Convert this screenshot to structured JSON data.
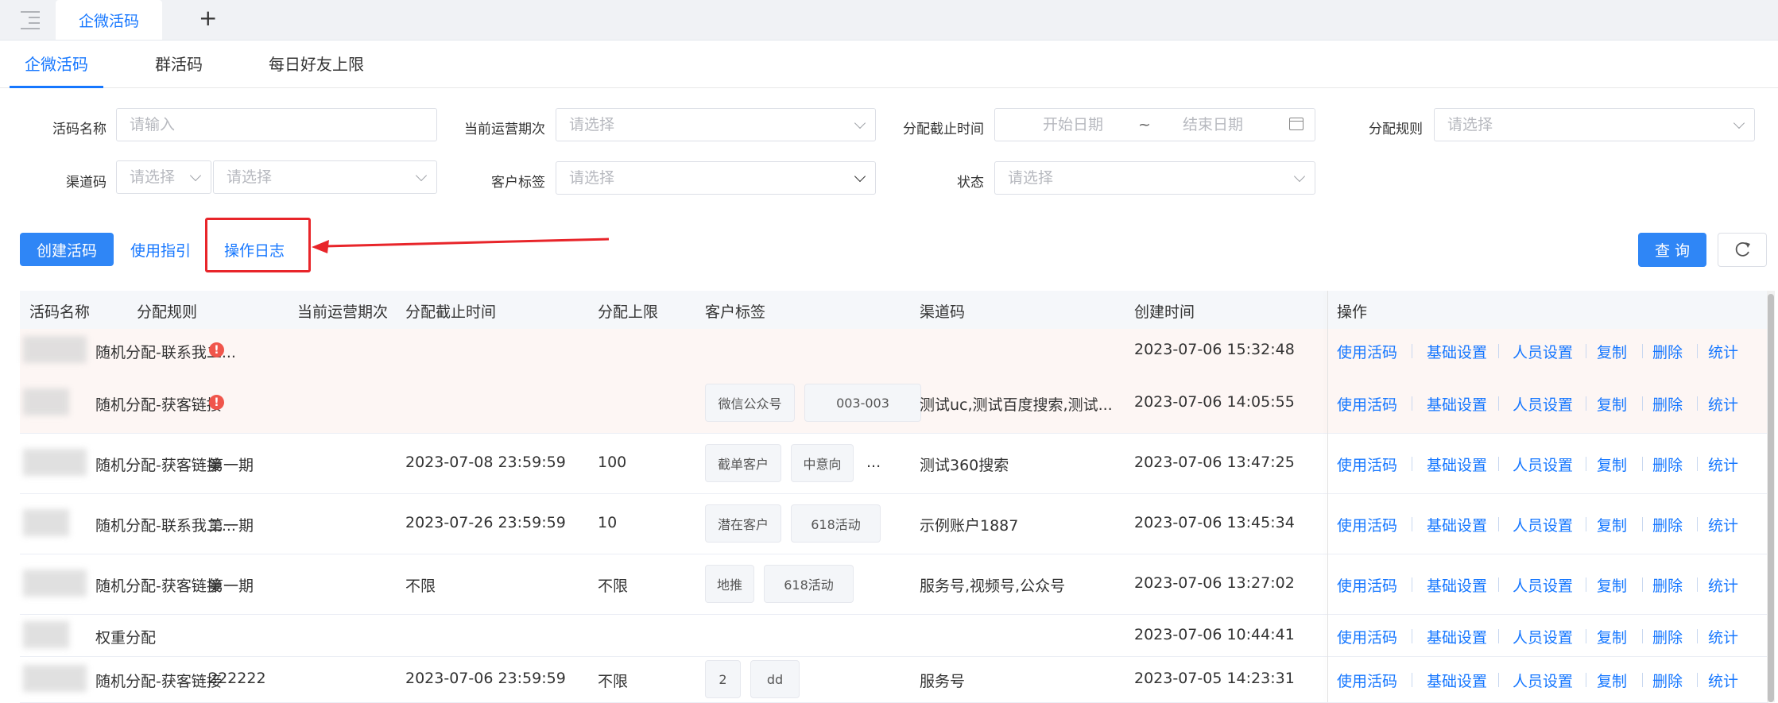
{
  "top_tabs": {
    "active": "企微活码",
    "add": "+"
  },
  "sub_tabs": [
    "企微活码",
    "群活码",
    "每日好友上限"
  ],
  "filters": {
    "name_label": "活码名称",
    "name_placeholder": "请输入",
    "period_label": "当前运营期次",
    "period_placeholder": "请选择",
    "deadline_label": "分配截止时间",
    "start_placeholder": "开始日期",
    "range_sep": "~",
    "end_placeholder": "结束日期",
    "rule_label": "分配规则",
    "rule_placeholder": "请选择",
    "channel_label": "渠道码",
    "channel_placeholder1": "请选择",
    "channel_placeholder2": "请选择",
    "tag_label": "客户标签",
    "tag_placeholder": "请选择",
    "status_label": "状态",
    "status_placeholder": "请选择"
  },
  "actions": {
    "create": "创建活码",
    "guide": "使用指引",
    "log": "操作日志",
    "query": "查 询"
  },
  "table": {
    "headers": [
      "活码名称",
      "分配规则",
      "当前运营期次",
      "分配截止时间",
      "分配上限",
      "客户标签",
      "渠道码",
      "创建时间",
      "操作"
    ],
    "ops": [
      "使用活码",
      "基础设置",
      "人员设置",
      "复制",
      "删除",
      "统计"
    ],
    "rows": [
      {
        "name": "",
        "rule": "随机分配-联系我二...",
        "alert": "!",
        "period": "",
        "deadline": "",
        "limit": "",
        "tags": [],
        "more": "",
        "channel": "",
        "created": "2023-07-06 15:32:48"
      },
      {
        "name": "",
        "rule": "随机分配-获客链接",
        "alert": "!",
        "period": "",
        "deadline": "",
        "limit": "",
        "tags": [
          "微信公众号",
          "003-003"
        ],
        "more": "",
        "channel": "测试uc,测试百度搜索,测试...",
        "created": "2023-07-06 14:05:55"
      },
      {
        "name": "",
        "rule": "随机分配-获客链接",
        "alert": "",
        "period": "第一期",
        "deadline": "2023-07-08 23:59:59",
        "limit": "100",
        "tags": [
          "截单客户",
          "中意向"
        ],
        "more": "...",
        "channel": "测试360搜索",
        "created": "2023-07-06 13:47:25"
      },
      {
        "name": "",
        "rule": "随机分配-联系我二...",
        "alert": "",
        "period": "第一期",
        "deadline": "2023-07-26 23:59:59",
        "limit": "10",
        "tags": [
          "潜在客户",
          "618活动"
        ],
        "more": "",
        "channel": "示例账户1887",
        "created": "2023-07-06 13:45:34"
      },
      {
        "name": "",
        "rule": "随机分配-获客链接",
        "alert": "",
        "period": "第一期",
        "deadline": "不限",
        "limit": "不限",
        "tags": [
          "地推",
          "618活动"
        ],
        "more": "",
        "channel": "服务号,视频号,公众号",
        "created": "2023-07-06 13:27:02"
      },
      {
        "name": "",
        "rule": "权重分配",
        "alert": "",
        "period": "",
        "deadline": "",
        "limit": "",
        "tags": [],
        "more": "",
        "channel": "",
        "created": "2023-07-06 10:44:41"
      },
      {
        "name": "",
        "rule": "随机分配-获客链接",
        "alert": "",
        "period": "222222",
        "deadline": "2023-07-06 23:59:59",
        "limit": "不限",
        "tags": [
          "2",
          "dd"
        ],
        "more": "",
        "channel": "服务号",
        "created": "2023-07-05 14:23:31"
      }
    ]
  },
  "colors": {
    "primary": "#1677ff",
    "button": "#2f86f6",
    "highlight": "#e8252a",
    "alert": "#f0554b",
    "row_highlight": "#fdf6f4"
  }
}
